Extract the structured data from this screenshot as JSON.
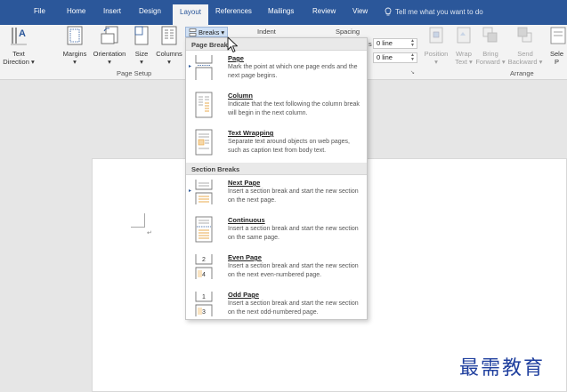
{
  "tabs": [
    {
      "label": "File"
    },
    {
      "label": "Home"
    },
    {
      "label": "Insert"
    },
    {
      "label": "Design"
    },
    {
      "label": "Layout"
    },
    {
      "label": "References"
    },
    {
      "label": "Mailings"
    },
    {
      "label": "Review"
    },
    {
      "label": "View"
    }
  ],
  "tell_me": "Tell me what you want to do",
  "ribbon": {
    "text_direction": [
      "Text",
      "Direction"
    ],
    "margins": "Margins",
    "orientation": "Orientation",
    "size": "Size",
    "columns": "Columns",
    "page_setup_label": "Page Setup",
    "breaks_label": "Breaks",
    "indent_label": "Indent",
    "spacing_label": "Spacing",
    "spacing_before": "0 line",
    "spacing_after": "0 line",
    "position": "Position",
    "wrap_text": [
      "Wrap",
      "Text"
    ],
    "bring_forward": [
      "Bring",
      "Forward"
    ],
    "send_backward": [
      "Send",
      "Backward"
    ],
    "selection_pane": [
      "Sele",
      "P"
    ],
    "arrange_label": "Arrange",
    "spacing_prefix": "s"
  },
  "breaks_menu": {
    "page_breaks_header": "Page Breaks",
    "section_breaks_header": "Section Breaks",
    "page_breaks": [
      {
        "title": "Page",
        "desc": "Mark the point at which one page ends and the next page begins."
      },
      {
        "title": "Column",
        "desc": "Indicate that the text following the column break will begin in the next column."
      },
      {
        "title": "Text Wrapping",
        "desc": "Separate text around objects on web pages, such as caption text from body text."
      }
    ],
    "section_breaks": [
      {
        "title": "Next Page",
        "desc": "Insert a section break and start the new section on the next page."
      },
      {
        "title": "Continuous",
        "desc": "Insert a section break and start the new section on the same page."
      },
      {
        "title": "Even Page",
        "desc": "Insert a section break and start the new section on the next even-numbered page.",
        "icon_numbers": [
          "2",
          "4"
        ]
      },
      {
        "title": "Odd Page",
        "desc": "Insert a section break and start the new section on the next odd-numbered page.",
        "icon_numbers": [
          "1",
          "3"
        ]
      }
    ]
  },
  "document": {
    "paragraph_mark": "↵"
  },
  "watermark": "最需教育",
  "colors": {
    "ribbon_blue": "#2b579a",
    "ribbon_bg": "#f3f3f3",
    "watermark": "#1f3f9e"
  }
}
